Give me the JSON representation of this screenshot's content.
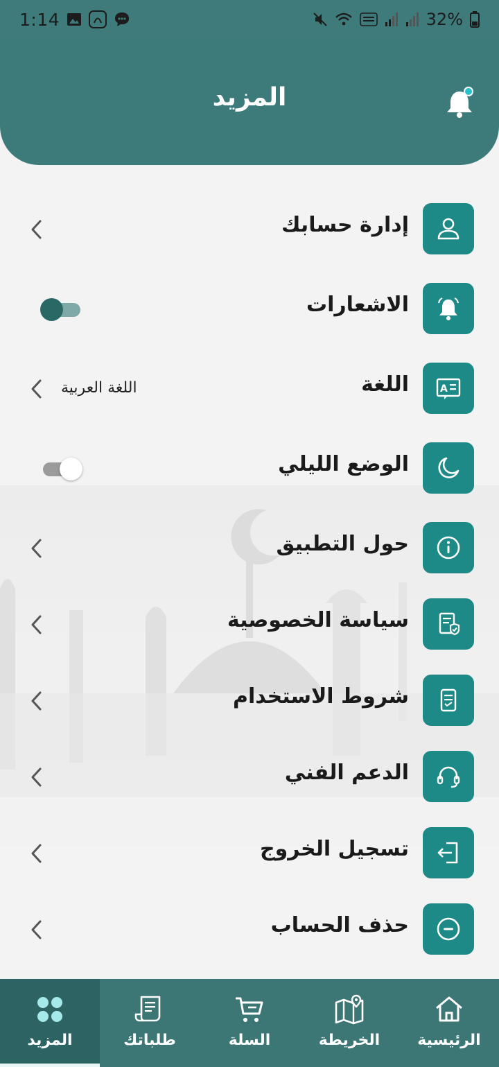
{
  "status_bar": {
    "time": "1:14",
    "battery": "32%"
  },
  "header": {
    "title": "المزيد"
  },
  "menu": {
    "items": [
      {
        "label": "إدارة حسابك",
        "icon": "user-icon",
        "control": "chevron"
      },
      {
        "label": "الاشعارات",
        "icon": "bell-icon",
        "control": "toggle-on"
      },
      {
        "label": "اللغة",
        "icon": "language-icon",
        "control": "chevron",
        "value": "اللغة العربية"
      },
      {
        "label": "الوضع الليلي",
        "icon": "moon-icon",
        "control": "toggle-off"
      },
      {
        "label": "حول التطبيق",
        "icon": "info-icon",
        "control": "chevron"
      },
      {
        "label": "سياسة الخصوصية",
        "icon": "privacy-document-icon",
        "control": "chevron"
      },
      {
        "label": "شروط الاستخدام",
        "icon": "terms-document-icon",
        "control": "chevron"
      },
      {
        "label": "الدعم الفني",
        "icon": "headset-icon",
        "control": "chevron"
      },
      {
        "label": "تسجيل الخروج",
        "icon": "logout-icon",
        "control": "chevron"
      },
      {
        "label": "حذف الحساب",
        "icon": "minus-circle-icon",
        "control": "chevron"
      }
    ]
  },
  "bottom_nav": {
    "items": [
      {
        "label": "الرئيسية",
        "icon": "home-icon",
        "active": false
      },
      {
        "label": "الخريطة",
        "icon": "map-icon",
        "active": false
      },
      {
        "label": "السلة",
        "icon": "cart-icon",
        "active": false
      },
      {
        "label": "طلباتك",
        "icon": "receipt-icon",
        "active": false
      },
      {
        "label": "المزيد",
        "icon": "grid-icon",
        "active": true
      }
    ]
  },
  "colors": {
    "header": "#3d7a7a",
    "icon_tile": "#1e8a87",
    "bottom_nav": "#3c7675",
    "background": "#f3f3f3"
  }
}
